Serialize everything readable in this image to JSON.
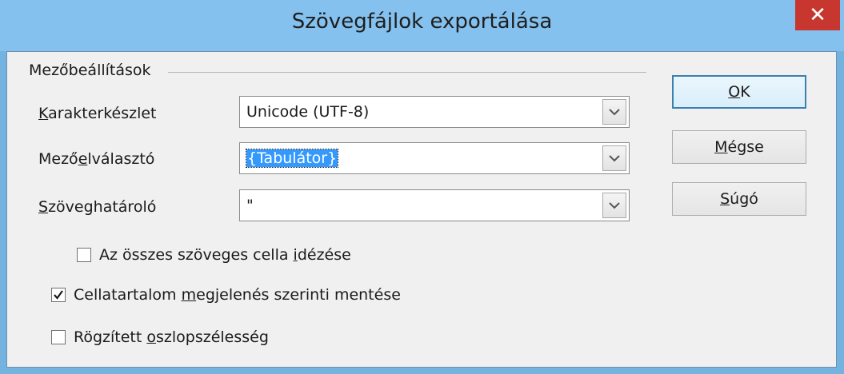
{
  "window": {
    "title": "Szövegfájlok exportálása",
    "close_glyph": "✕",
    "accent_color": "#84c1ee",
    "close_color": "#c7372f"
  },
  "group": {
    "title": "Mezőbeállítások"
  },
  "fields": {
    "charset": {
      "label_pre": "",
      "label_mnemonic": "K",
      "label_post": "arakterkészlet",
      "value": "Unicode (UTF-8)"
    },
    "separator": {
      "label_pre": "Mező",
      "label_mnemonic": "e",
      "label_post": "lválasztó",
      "value": "{Tabulátor}"
    },
    "text_delimiter": {
      "label_pre": "",
      "label_mnemonic": "S",
      "label_post": "zöveghatároló",
      "value": "\""
    }
  },
  "checkboxes": {
    "quote_all": {
      "label_pre": "Az összes szöveges cella ",
      "label_mnemonic": "i",
      "label_post": "dézése",
      "checked": false
    },
    "save_as_shown": {
      "label_pre": "Cellatartalom ",
      "label_mnemonic": "m",
      "label_post": "egjelenés szerinti mentése",
      "checked": true
    },
    "fixed_width": {
      "label_pre": "Rögzített ",
      "label_mnemonic": "o",
      "label_post": "szlopszélesség",
      "checked": false
    }
  },
  "buttons": {
    "ok": {
      "mnemonic": "O",
      "rest": "K"
    },
    "cancel": {
      "mnemonic": "M",
      "rest": "égse"
    },
    "help": {
      "mnemonic": "S",
      "rest": "úgó"
    }
  },
  "icons": {
    "dropdown": "chevron-down-icon",
    "check": "checkmark-icon",
    "close": "close-icon"
  }
}
